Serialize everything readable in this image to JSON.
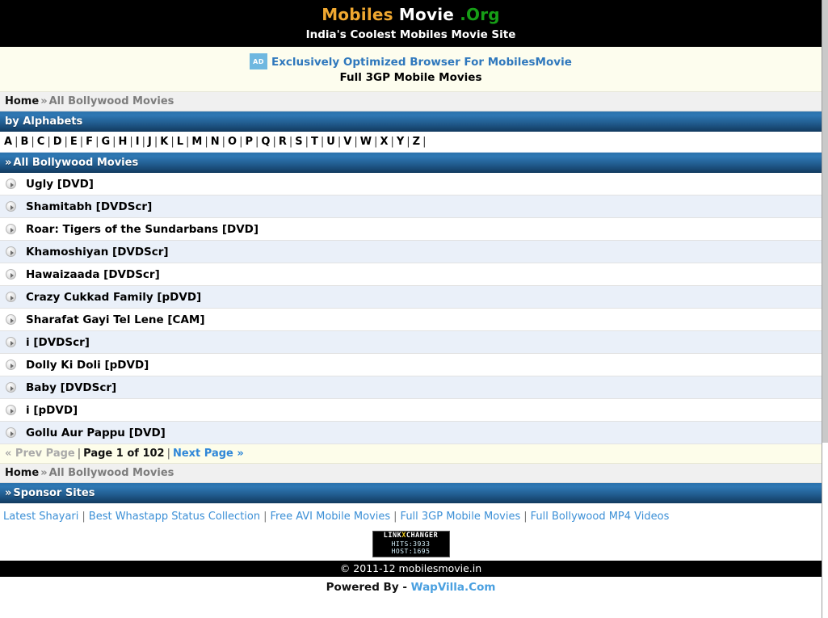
{
  "site": {
    "logo_part1": "Mobiles",
    "logo_part2": "Movie",
    "logo_part3": ".Org",
    "tagline": "India's Coolest Mobiles Movie Site"
  },
  "ad": {
    "badge": "AD",
    "link_text": "Exclusively Optimized Browser For MobilesMovie",
    "subtitle": "Full 3GP Mobile Movies"
  },
  "breadcrumb": {
    "home": "Home",
    "separator": "»",
    "current": "All Bollywood Movies"
  },
  "alphabets_bar": {
    "title": "by Alphabets",
    "letters": [
      "A",
      "B",
      "C",
      "D",
      "E",
      "F",
      "G",
      "H",
      "I",
      "J",
      "K",
      "L",
      "M",
      "N",
      "O",
      "P",
      "Q",
      "R",
      "S",
      "T",
      "U",
      "V",
      "W",
      "X",
      "Y",
      "Z"
    ],
    "separator": "|"
  },
  "movies_section": {
    "chevron": "»",
    "title": "All Bollywood Movies",
    "items": [
      {
        "title": "Ugly [DVD]"
      },
      {
        "title": "Shamitabh [DVDScr]"
      },
      {
        "title": "Roar: Tigers of the Sundarbans [DVD]"
      },
      {
        "title": "Khamoshiyan [DVDScr]"
      },
      {
        "title": "Hawaizaada [DVDScr]"
      },
      {
        "title": "Crazy Cukkad Family [pDVD]"
      },
      {
        "title": "Sharafat Gayi Tel Lene [CAM]"
      },
      {
        "title": "i [DVDScr]"
      },
      {
        "title": "Dolly Ki Doli [pDVD]"
      },
      {
        "title": "Baby [DVDScr]"
      },
      {
        "title": "i [pDVD]"
      },
      {
        "title": "Gollu Aur Pappu [DVD]"
      }
    ]
  },
  "pagination": {
    "prev": "« Prev Page",
    "sep1": "|",
    "current": "Page 1 of 102",
    "sep2": "|",
    "next": "Next Page »"
  },
  "sponsor_section": {
    "chevron": "»",
    "title": "Sponsor Sites",
    "links": [
      "Latest Shayari",
      "Best Whastapp Status Collection",
      "Free AVI Mobile Movies",
      "Full 3GP Mobile Movies",
      "Full Bollywood MP4 Videos"
    ],
    "separator": "|"
  },
  "counter": {
    "brand_left": "LINK",
    "brand_x": "X",
    "brand_right": "CHANGER",
    "hits": "HITS:3933",
    "host": "HOST:1695"
  },
  "footer": {
    "copyright": "© 2011-12 mobilesmovie.in",
    "powered_prefix": "Powered By -",
    "powered_link": "WapVilla.Com"
  },
  "colors": {
    "logo_orange": "#f0a830",
    "logo_green": "#169e16",
    "bar_blue_top": "#2b72ac",
    "bar_blue_bottom": "#123a5f",
    "link_blue": "#3b8fd6",
    "row_alt": "#eaf0f9",
    "ad_bg": "#fdfdee"
  }
}
